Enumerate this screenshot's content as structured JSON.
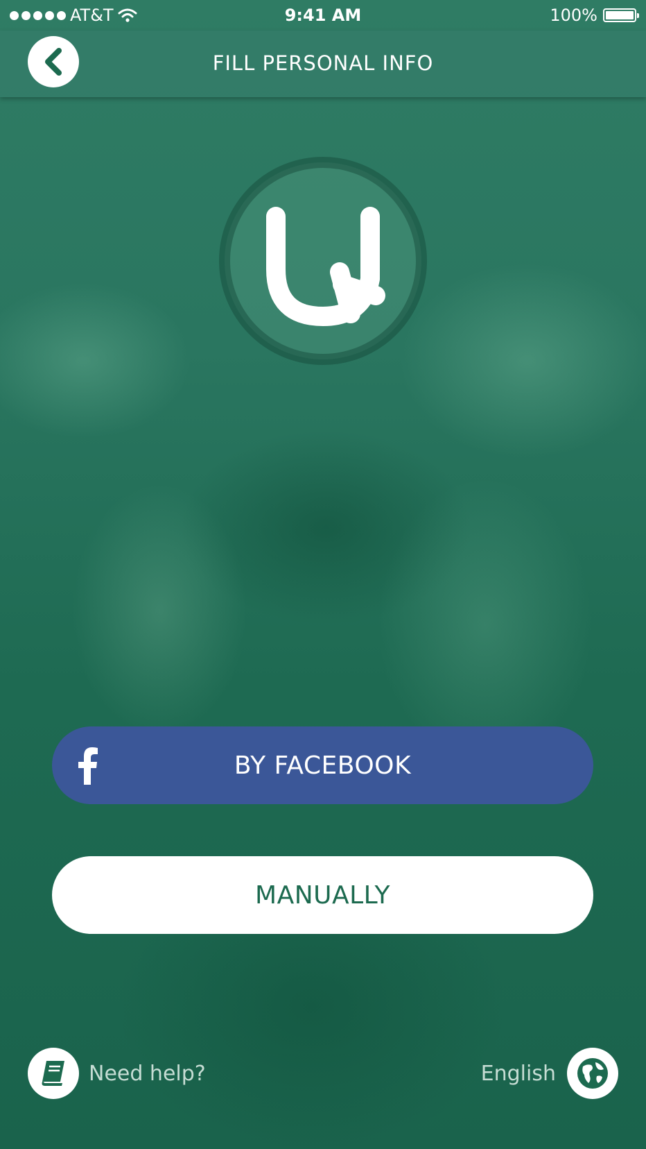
{
  "status_bar": {
    "carrier": "AT&T",
    "time": "9:41 AM",
    "battery": "100%",
    "signal_icon": "signal-dots-icon",
    "wifi_icon": "wifi-icon",
    "battery_icon": "battery-icon"
  },
  "header": {
    "title": "FILL PERSONAL INFO",
    "back_icon": "chevron-left-icon"
  },
  "logo": {
    "icon": "app-logo-icon"
  },
  "actions": {
    "facebook_label": "BY FACEBOOK",
    "facebook_icon": "facebook-icon",
    "manual_label": "MANUALLY"
  },
  "footer": {
    "help_label": "Need help?",
    "help_icon": "book-icon",
    "language_label": "English",
    "language_icon": "globe-icon"
  },
  "colors": {
    "background": "#1e6a52",
    "facebook": "#3b5798",
    "brand_green": "#1c6a4f",
    "white": "#ffffff"
  }
}
